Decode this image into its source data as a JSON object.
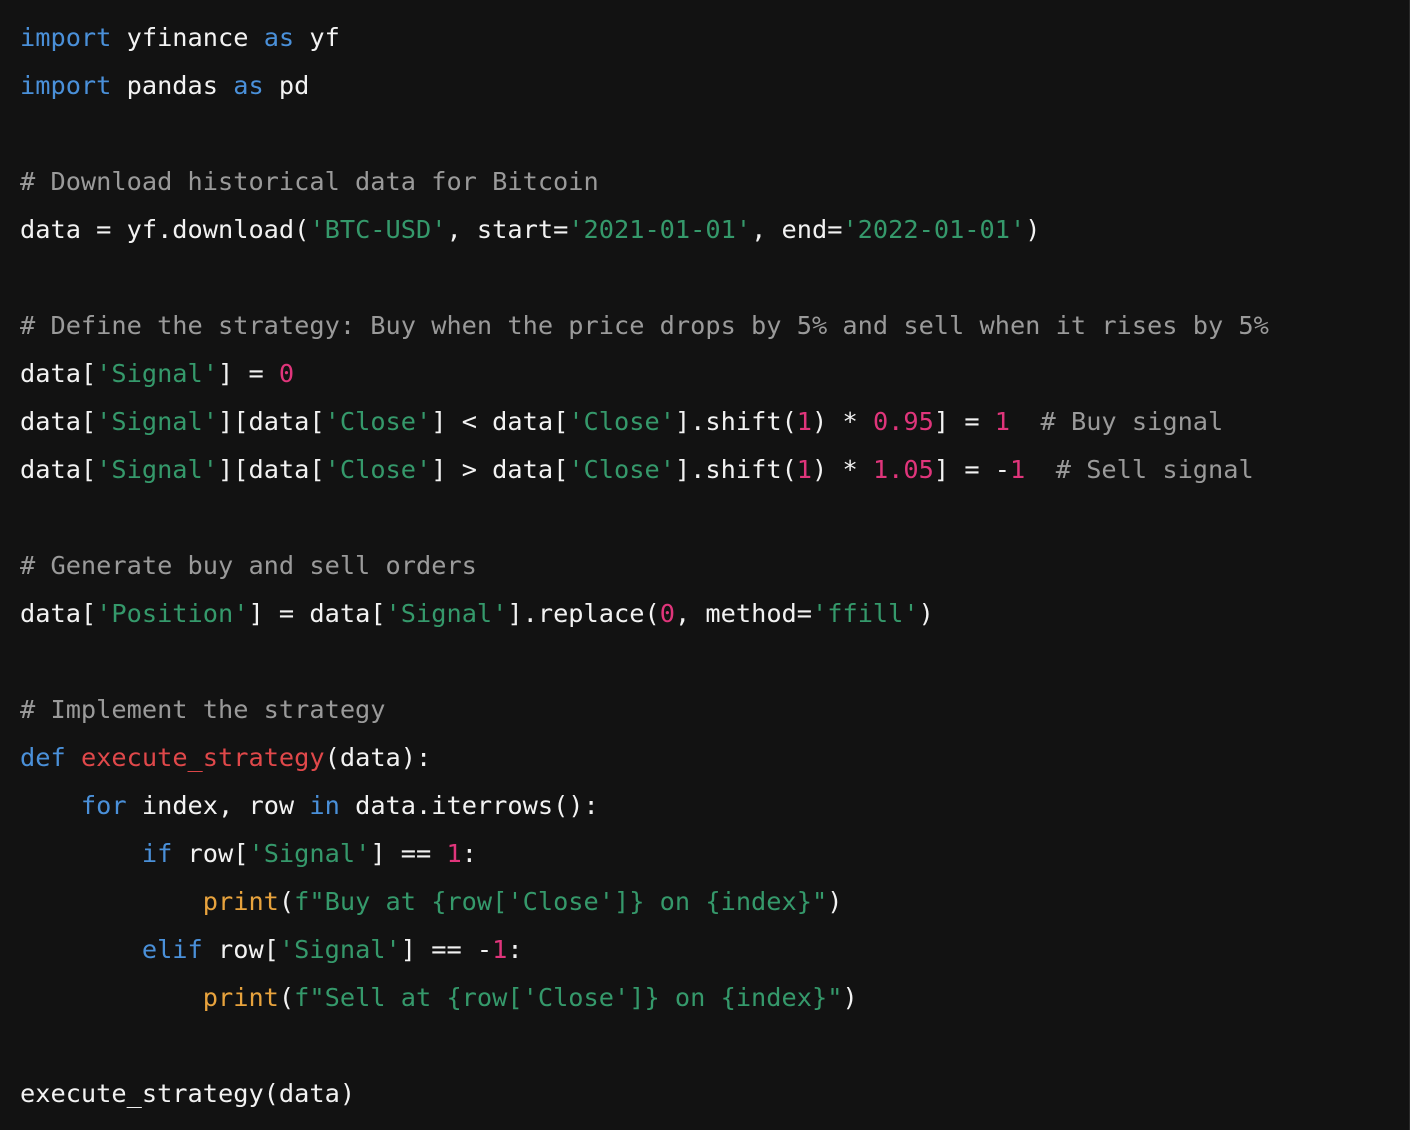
{
  "editor": {
    "language": "python",
    "background_color": "#121212",
    "default_text_color": "#f2f2f2",
    "theme_colors": {
      "keyword": "#4a90d9",
      "function_name": "#e0484a",
      "builtin_call": "#e8a33d",
      "string": "#35996b",
      "number": "#e0357b",
      "comment": "#9a9a9a",
      "plain": "#f2f2f2"
    }
  },
  "code": {
    "plain_text": "import yfinance as yf\nimport pandas as pd\n\n# Download historical data for Bitcoin\ndata = yf.download('BTC-USD', start='2021-01-01', end='2022-01-01')\n\n# Define the strategy: Buy when the price drops by 5% and sell when it rises by 5%\ndata['Signal'] = 0\ndata['Signal'][data['Close'] < data['Close'].shift(1) * 0.95] = 1  # Buy signal\ndata['Signal'][data['Close'] > data['Close'].shift(1) * 1.05] = -1  # Sell signal\n\n# Generate buy and sell orders\ndata['Position'] = data['Signal'].replace(0, method='ffill')\n\n# Implement the strategy\ndef execute_strategy(data):\n    for index, row in data.iterrows():\n        if row['Signal'] == 1:\n            print(f\"Buy at {row['Close']} on {index}\")\n        elif row['Signal'] == -1:\n            print(f\"Sell at {row['Close']} on {index}\")\n\nexecute_strategy(data)",
    "lines": [
      {
        "n": 1,
        "tokens": [
          {
            "t": "import",
            "c": "kw"
          },
          {
            "t": " yfinance ",
            "c": "plain"
          },
          {
            "t": "as",
            "c": "kw"
          },
          {
            "t": " yf",
            "c": "plain"
          }
        ]
      },
      {
        "n": 2,
        "tokens": [
          {
            "t": "import",
            "c": "kw"
          },
          {
            "t": " pandas ",
            "c": "plain"
          },
          {
            "t": "as",
            "c": "kw"
          },
          {
            "t": " pd",
            "c": "plain"
          }
        ]
      },
      {
        "n": 3,
        "tokens": []
      },
      {
        "n": 4,
        "tokens": [
          {
            "t": "# Download historical data for Bitcoin",
            "c": "cmt"
          }
        ]
      },
      {
        "n": 5,
        "tokens": [
          {
            "t": "data = yf.download(",
            "c": "plain"
          },
          {
            "t": "'BTC-USD'",
            "c": "str"
          },
          {
            "t": ", start=",
            "c": "plain"
          },
          {
            "t": "'2021-01-01'",
            "c": "str"
          },
          {
            "t": ", end=",
            "c": "plain"
          },
          {
            "t": "'2022-01-01'",
            "c": "str"
          },
          {
            "t": ")",
            "c": "plain"
          }
        ]
      },
      {
        "n": 6,
        "tokens": []
      },
      {
        "n": 7,
        "tokens": [
          {
            "t": "# Define the strategy: Buy when the price drops by 5% and sell when it rises by 5%",
            "c": "cmt"
          }
        ]
      },
      {
        "n": 8,
        "tokens": [
          {
            "t": "data[",
            "c": "plain"
          },
          {
            "t": "'Signal'",
            "c": "str"
          },
          {
            "t": "] = ",
            "c": "plain"
          },
          {
            "t": "0",
            "c": "num"
          }
        ]
      },
      {
        "n": 9,
        "tokens": [
          {
            "t": "data[",
            "c": "plain"
          },
          {
            "t": "'Signal'",
            "c": "str"
          },
          {
            "t": "][data[",
            "c": "plain"
          },
          {
            "t": "'Close'",
            "c": "str"
          },
          {
            "t": "] < data[",
            "c": "plain"
          },
          {
            "t": "'Close'",
            "c": "str"
          },
          {
            "t": "].shift(",
            "c": "plain"
          },
          {
            "t": "1",
            "c": "num"
          },
          {
            "t": ") * ",
            "c": "plain"
          },
          {
            "t": "0.95",
            "c": "num"
          },
          {
            "t": "] = ",
            "c": "plain"
          },
          {
            "t": "1",
            "c": "num"
          },
          {
            "t": "  ",
            "c": "plain"
          },
          {
            "t": "# Buy signal",
            "c": "cmt"
          }
        ]
      },
      {
        "n": 10,
        "tokens": [
          {
            "t": "data[",
            "c": "plain"
          },
          {
            "t": "'Signal'",
            "c": "str"
          },
          {
            "t": "][data[",
            "c": "plain"
          },
          {
            "t": "'Close'",
            "c": "str"
          },
          {
            "t": "] > data[",
            "c": "plain"
          },
          {
            "t": "'Close'",
            "c": "str"
          },
          {
            "t": "].shift(",
            "c": "plain"
          },
          {
            "t": "1",
            "c": "num"
          },
          {
            "t": ") * ",
            "c": "plain"
          },
          {
            "t": "1.05",
            "c": "num"
          },
          {
            "t": "] = -",
            "c": "plain"
          },
          {
            "t": "1",
            "c": "num"
          },
          {
            "t": "  ",
            "c": "plain"
          },
          {
            "t": "# Sell signal",
            "c": "cmt"
          }
        ]
      },
      {
        "n": 11,
        "tokens": []
      },
      {
        "n": 12,
        "tokens": [
          {
            "t": "# Generate buy and sell orders",
            "c": "cmt"
          }
        ]
      },
      {
        "n": 13,
        "tokens": [
          {
            "t": "data[",
            "c": "plain"
          },
          {
            "t": "'Position'",
            "c": "str"
          },
          {
            "t": "] = data[",
            "c": "plain"
          },
          {
            "t": "'Signal'",
            "c": "str"
          },
          {
            "t": "].replace(",
            "c": "plain"
          },
          {
            "t": "0",
            "c": "num"
          },
          {
            "t": ", method=",
            "c": "plain"
          },
          {
            "t": "'ffill'",
            "c": "str"
          },
          {
            "t": ")",
            "c": "plain"
          }
        ]
      },
      {
        "n": 14,
        "tokens": []
      },
      {
        "n": 15,
        "tokens": [
          {
            "t": "# Implement the strategy",
            "c": "cmt"
          }
        ]
      },
      {
        "n": 16,
        "tokens": [
          {
            "t": "def",
            "c": "kw"
          },
          {
            "t": " ",
            "c": "plain"
          },
          {
            "t": "execute_strategy",
            "c": "fn"
          },
          {
            "t": "(data):",
            "c": "plain"
          }
        ]
      },
      {
        "n": 17,
        "tokens": [
          {
            "t": "    ",
            "c": "plain"
          },
          {
            "t": "for",
            "c": "kw"
          },
          {
            "t": " index, row ",
            "c": "plain"
          },
          {
            "t": "in",
            "c": "kw"
          },
          {
            "t": " data.iterrows():",
            "c": "plain"
          }
        ]
      },
      {
        "n": 18,
        "tokens": [
          {
            "t": "        ",
            "c": "plain"
          },
          {
            "t": "if",
            "c": "kw"
          },
          {
            "t": " row[",
            "c": "plain"
          },
          {
            "t": "'Signal'",
            "c": "str"
          },
          {
            "t": "] == ",
            "c": "plain"
          },
          {
            "t": "1",
            "c": "num"
          },
          {
            "t": ":",
            "c": "plain"
          }
        ]
      },
      {
        "n": 19,
        "tokens": [
          {
            "t": "            ",
            "c": "plain"
          },
          {
            "t": "print",
            "c": "call"
          },
          {
            "t": "(",
            "c": "plain"
          },
          {
            "t": "f\"Buy at {row['Close']} on {index}\"",
            "c": "str"
          },
          {
            "t": ")",
            "c": "plain"
          }
        ]
      },
      {
        "n": 20,
        "tokens": [
          {
            "t": "        ",
            "c": "plain"
          },
          {
            "t": "elif",
            "c": "kw"
          },
          {
            "t": " row[",
            "c": "plain"
          },
          {
            "t": "'Signal'",
            "c": "str"
          },
          {
            "t": "] == -",
            "c": "plain"
          },
          {
            "t": "1",
            "c": "num"
          },
          {
            "t": ":",
            "c": "plain"
          }
        ]
      },
      {
        "n": 21,
        "tokens": [
          {
            "t": "            ",
            "c": "plain"
          },
          {
            "t": "print",
            "c": "call"
          },
          {
            "t": "(",
            "c": "plain"
          },
          {
            "t": "f\"Sell at {row['Close']} on {index}\"",
            "c": "str"
          },
          {
            "t": ")",
            "c": "plain"
          }
        ]
      },
      {
        "n": 22,
        "tokens": []
      },
      {
        "n": 23,
        "tokens": [
          {
            "t": "execute_strategy(data)",
            "c": "plain"
          }
        ]
      }
    ]
  }
}
